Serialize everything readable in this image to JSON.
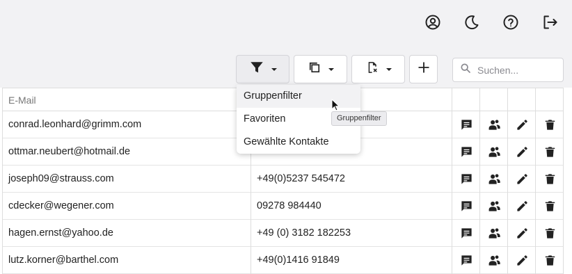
{
  "topbar": {
    "icons": [
      "account-icon",
      "dark-mode-icon",
      "help-icon",
      "logout-icon"
    ]
  },
  "toolbar": {
    "filter_button": "filter-icon",
    "copy_button": "copy-icon",
    "export_button": "export-icon",
    "add_button": "add-icon"
  },
  "search": {
    "placeholder": "Suchen..."
  },
  "dropdown": {
    "items": [
      "Gruppenfilter",
      "Favoriten",
      "Gewählte Kontakte"
    ],
    "hovered_index": 0
  },
  "tooltip": {
    "text": "Gruppenfilter"
  },
  "table": {
    "headers": {
      "email": "E-Mail",
      "phone": ""
    },
    "rows": [
      {
        "email": "conrad.leonhard@grimm.com",
        "phone": ""
      },
      {
        "email": "ottmar.neubert@hotmail.de",
        "phone": ""
      },
      {
        "email": "joseph09@strauss.com",
        "phone": "+49(0)5237 545472"
      },
      {
        "email": "cdecker@wegener.com",
        "phone": "09278 984440"
      },
      {
        "email": "hagen.ernst@yahoo.de",
        "phone": "+49 (0) 3182 182253"
      },
      {
        "email": "lutz.korner@barthel.com",
        "phone": "+49(0)1416 91849"
      }
    ],
    "row_actions": [
      "message-icon",
      "group-icon",
      "edit-icon",
      "delete-icon"
    ]
  },
  "colors": {
    "background": "#f2f2f4",
    "border": "#d4d4d8",
    "icon": "#222222",
    "tooltip_bg": "#ececef"
  }
}
